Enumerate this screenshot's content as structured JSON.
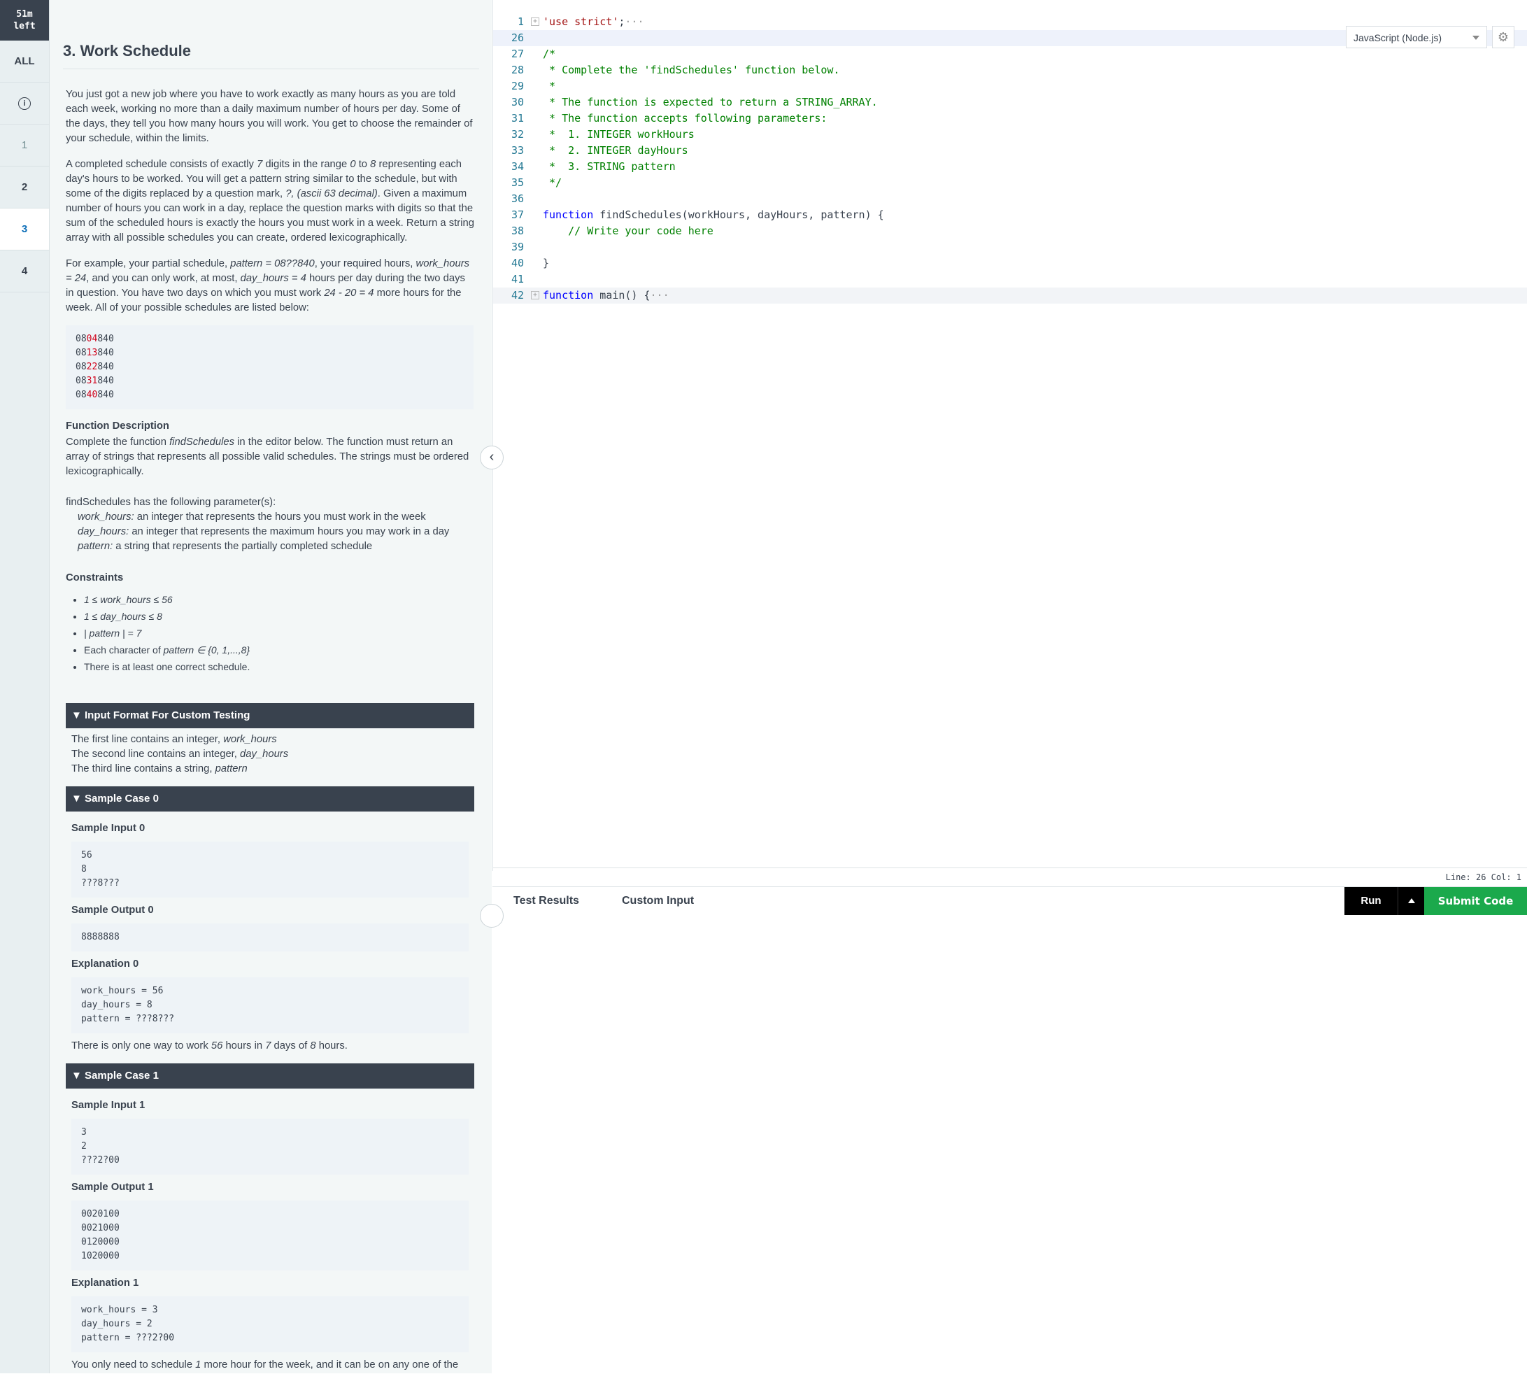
{
  "timer": {
    "line1": "51m",
    "line2": "left"
  },
  "rail": {
    "all": "ALL",
    "info": "i",
    "q1": "1",
    "q2": "2",
    "q3": "3",
    "q4": "4"
  },
  "problem": {
    "title": "3. Work Schedule",
    "p1": "You just got a new job where you have to work exactly as many hours as you are told each week, working no more than a daily maximum number of hours per day. Some of the days, they tell you how many hours you will work. You get to choose the remainder of your schedule, within the limits.",
    "p2a": "A completed schedule consists of exactly ",
    "p2b": "7",
    "p2c": " digits in the range ",
    "p2d": "0",
    "p2e": " to ",
    "p2f": "8",
    "p2g": " representing each day's hours to be worked. You will get a pattern string similar to the schedule, but with some of the digits replaced by a question mark, ",
    "p2h": "?, (ascii 63 decimal)",
    "p2i": ". Given a maximum number of hours you can work in a day, replace the question marks with digits so that the sum of the scheduled hours is exactly the hours you must work in a week. Return a string array with all possible schedules you can create, ordered lexicographically.",
    "p3a": "For example, your partial schedule, ",
    "p3b": "pattern = 08??840",
    "p3c": ", your required hours, ",
    "p3d": "work_hours = 24",
    "p3e": ", and you can only work, at most, ",
    "p3f": "day_hours = 4",
    "p3g": " hours per day during the two days in question. You have two days on which you must work ",
    "p3h": "24 - 20 = 4",
    "p3i": " more hours for the week. All of your possible schedules are listed below:",
    "schedules": [
      {
        "pre": "08",
        "mid": "04",
        "post": "840"
      },
      {
        "pre": "08",
        "mid": "13",
        "post": "840"
      },
      {
        "pre": "08",
        "mid": "22",
        "post": "840"
      },
      {
        "pre": "08",
        "mid": "31",
        "post": "840"
      },
      {
        "pre": "08",
        "mid": "40",
        "post": "840"
      }
    ],
    "fd_head": "Function Description",
    "fd_a": "Complete the function ",
    "fd_b": "findSchedules",
    "fd_c": " in the editor below. The function must return an array of strings that represents all possible valid schedules. The strings must be ordered lexicographically.",
    "params_intro": "findSchedules has the following parameter(s):",
    "params": [
      {
        "name": "work_hours:",
        "desc": "  an integer that represents the hours you must work in the week"
      },
      {
        "name": "day_hours:",
        "desc": "  an integer that represents the maximum hours you may work in a day"
      },
      {
        "name": "pattern:",
        "desc": "  a string that represents the partially completed schedule"
      }
    ],
    "cons_head": "Constraints",
    "constraints": [
      "1 ≤ work_hours ≤ 56",
      "1 ≤ day_hours ≤ 8",
      "| pattern | = 7"
    ],
    "cons4a": "Each character of ",
    "cons4b": "pattern ∈ {0, 1,...,8}",
    "cons5": "There is at least one correct schedule.",
    "input_head": "Input Format For Custom Testing",
    "input_lines": [
      {
        "a": "The first line contains an integer, ",
        "b": "work_hours"
      },
      {
        "a": "The second line contains an integer, ",
        "b": "day_hours"
      },
      {
        "a": "The third line contains a string, ",
        "b": "pattern"
      }
    ],
    "s0_head": "Sample Case 0",
    "s0_in_h": "Sample Input 0",
    "s0_in": [
      "56",
      "8",
      "???8???"
    ],
    "s0_out_h": "Sample Output 0",
    "s0_out": [
      "8888888"
    ],
    "s0_exp_h": "Explanation 0",
    "s0_exp": [
      "work_hours = 56",
      "day_hours = 8",
      "pattern = ???8???"
    ],
    "s0_note_a": "There is only one way to work ",
    "s0_note_b": "56",
    "s0_note_c": " hours in ",
    "s0_note_d": "7",
    "s0_note_e": " days of ",
    "s0_note_f": "8",
    "s0_note_g": " hours.",
    "s1_head": "Sample Case 1",
    "s1_in_h": "Sample Input 1",
    "s1_in": [
      "3",
      "2",
      "???2?00"
    ],
    "s1_out_h": "Sample Output 1",
    "s1_out": [
      "0020100",
      "0021000",
      "0120000",
      "1020000"
    ],
    "s1_exp_h": "Explanation 1",
    "s1_exp": [
      "work_hours = 3",
      "day_hours = 2",
      "pattern = ???2?00"
    ],
    "s1_note_a": "You only need to schedule ",
    "s1_note_b": "1",
    "s1_note_c": " more hour for the week, and it can be on any one of the days in question."
  },
  "editor": {
    "language": "JavaScript (Node.js)",
    "status": "Line: 26 Col: 1",
    "lines": [
      {
        "n": "1",
        "fold": true,
        "parts": [
          {
            "c": "str",
            "t": "'use strict'"
          },
          {
            "c": "",
            "t": ";"
          },
          {
            "c": "dots",
            "t": "···"
          }
        ]
      },
      {
        "n": "26",
        "cur": true,
        "parts": []
      },
      {
        "n": "27",
        "parts": [
          {
            "c": "cm",
            "t": "/*"
          }
        ]
      },
      {
        "n": "28",
        "parts": [
          {
            "c": "cm",
            "t": " * Complete the 'findSchedules' function below."
          }
        ]
      },
      {
        "n": "29",
        "parts": [
          {
            "c": "cm",
            "t": " *"
          }
        ]
      },
      {
        "n": "30",
        "parts": [
          {
            "c": "cm",
            "t": " * The function is expected to return a STRING_ARRAY."
          }
        ]
      },
      {
        "n": "31",
        "parts": [
          {
            "c": "cm",
            "t": " * The function accepts following parameters:"
          }
        ]
      },
      {
        "n": "32",
        "parts": [
          {
            "c": "cm",
            "t": " *  1. INTEGER workHours"
          }
        ]
      },
      {
        "n": "33",
        "parts": [
          {
            "c": "cm",
            "t": " *  2. INTEGER dayHours"
          }
        ]
      },
      {
        "n": "34",
        "parts": [
          {
            "c": "cm",
            "t": " *  3. STRING pattern"
          }
        ]
      },
      {
        "n": "35",
        "parts": [
          {
            "c": "cm",
            "t": " */"
          }
        ]
      },
      {
        "n": "36",
        "parts": []
      },
      {
        "n": "37",
        "parts": [
          {
            "c": "kw",
            "t": "function"
          },
          {
            "c": "",
            "t": " findSchedules(workHours, dayHours, pattern) {"
          }
        ]
      },
      {
        "n": "38",
        "parts": [
          {
            "c": "cm",
            "t": "    // Write your code here"
          }
        ]
      },
      {
        "n": "39",
        "parts": []
      },
      {
        "n": "40",
        "parts": [
          {
            "c": "",
            "t": "}"
          }
        ]
      },
      {
        "n": "41",
        "parts": []
      },
      {
        "n": "42",
        "fold": true,
        "band": true,
        "parts": [
          {
            "c": "kw",
            "t": "function"
          },
          {
            "c": "",
            "t": " main() {"
          },
          {
            "c": "dots",
            "t": "···"
          }
        ]
      }
    ]
  },
  "bottom": {
    "tab1": "Test Results",
    "tab2": "Custom Input",
    "run": "Run",
    "submit": "Submit Code"
  }
}
